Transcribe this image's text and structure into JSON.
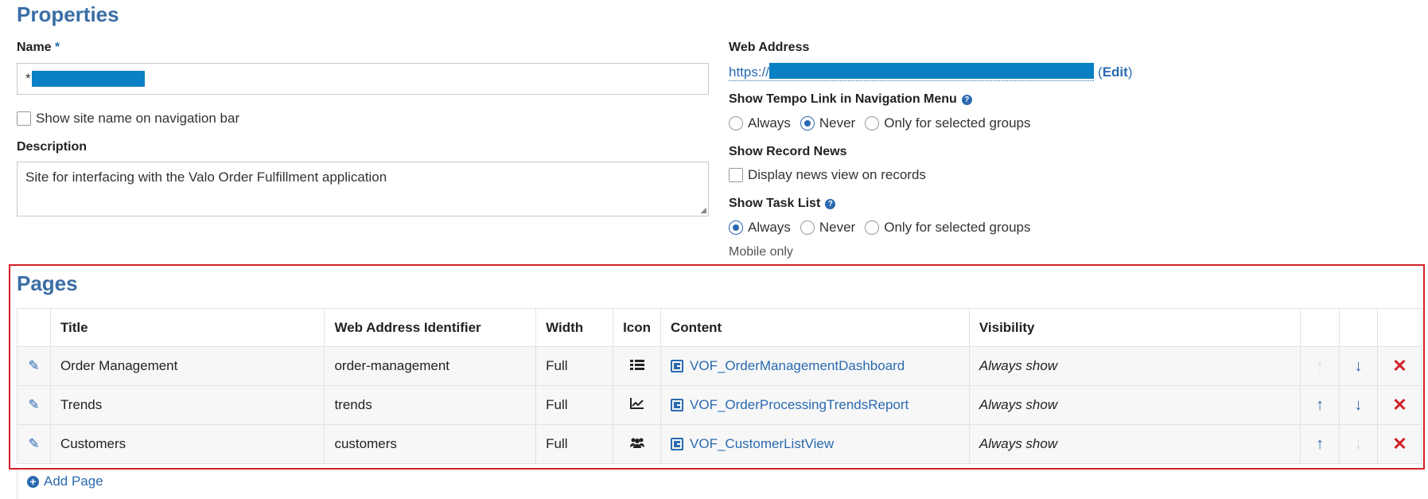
{
  "properties": {
    "title": "Properties",
    "name_label": "Name",
    "required_mark": "*",
    "name_value_prefix": "*",
    "show_site_name_label": "Show site name on navigation bar",
    "description_label": "Description",
    "description_value": "Site for interfacing with the Valo Order Fulfillment application",
    "web_address_label": "Web Address",
    "web_address_prefix": "https://",
    "edit_label": "Edit",
    "tempo_link_label": "Show Tempo Link in Navigation Menu",
    "tempo_options": [
      "Always",
      "Never",
      "Only for selected groups"
    ],
    "tempo_selected": "Never",
    "record_news_label": "Show Record News",
    "record_news_checkbox_label": "Display news view on records",
    "task_list_label": "Show Task List",
    "task_options": [
      "Always",
      "Never",
      "Only for selected groups"
    ],
    "task_selected": "Always",
    "mobile_only": "Mobile only",
    "help_icon": "question-circle-icon",
    "accent_color": "#2a6ab0",
    "highlight_border_color": "#d32027"
  },
  "pages": {
    "title": "Pages",
    "columns": [
      "Title",
      "Web Address Identifier",
      "Width",
      "Icon",
      "Content",
      "Visibility"
    ],
    "rows": [
      {
        "title": "Order Management",
        "identifier": "order-management",
        "width": "Full",
        "icon": "list-icon",
        "content": "VOF_OrderManagementDashboard",
        "visibility": "Always show",
        "can_move_up": false,
        "can_move_down": true
      },
      {
        "title": "Trends",
        "identifier": "trends",
        "width": "Full",
        "icon": "line-chart-icon",
        "content": "VOF_OrderProcessingTrendsReport",
        "visibility": "Always show",
        "can_move_up": true,
        "can_move_down": true
      },
      {
        "title": "Customers",
        "identifier": "customers",
        "width": "Full",
        "icon": "users-icon",
        "content": "VOF_CustomerListView",
        "visibility": "Always show",
        "can_move_up": true,
        "can_move_down": false
      }
    ],
    "add_page_label": "Add Page"
  }
}
